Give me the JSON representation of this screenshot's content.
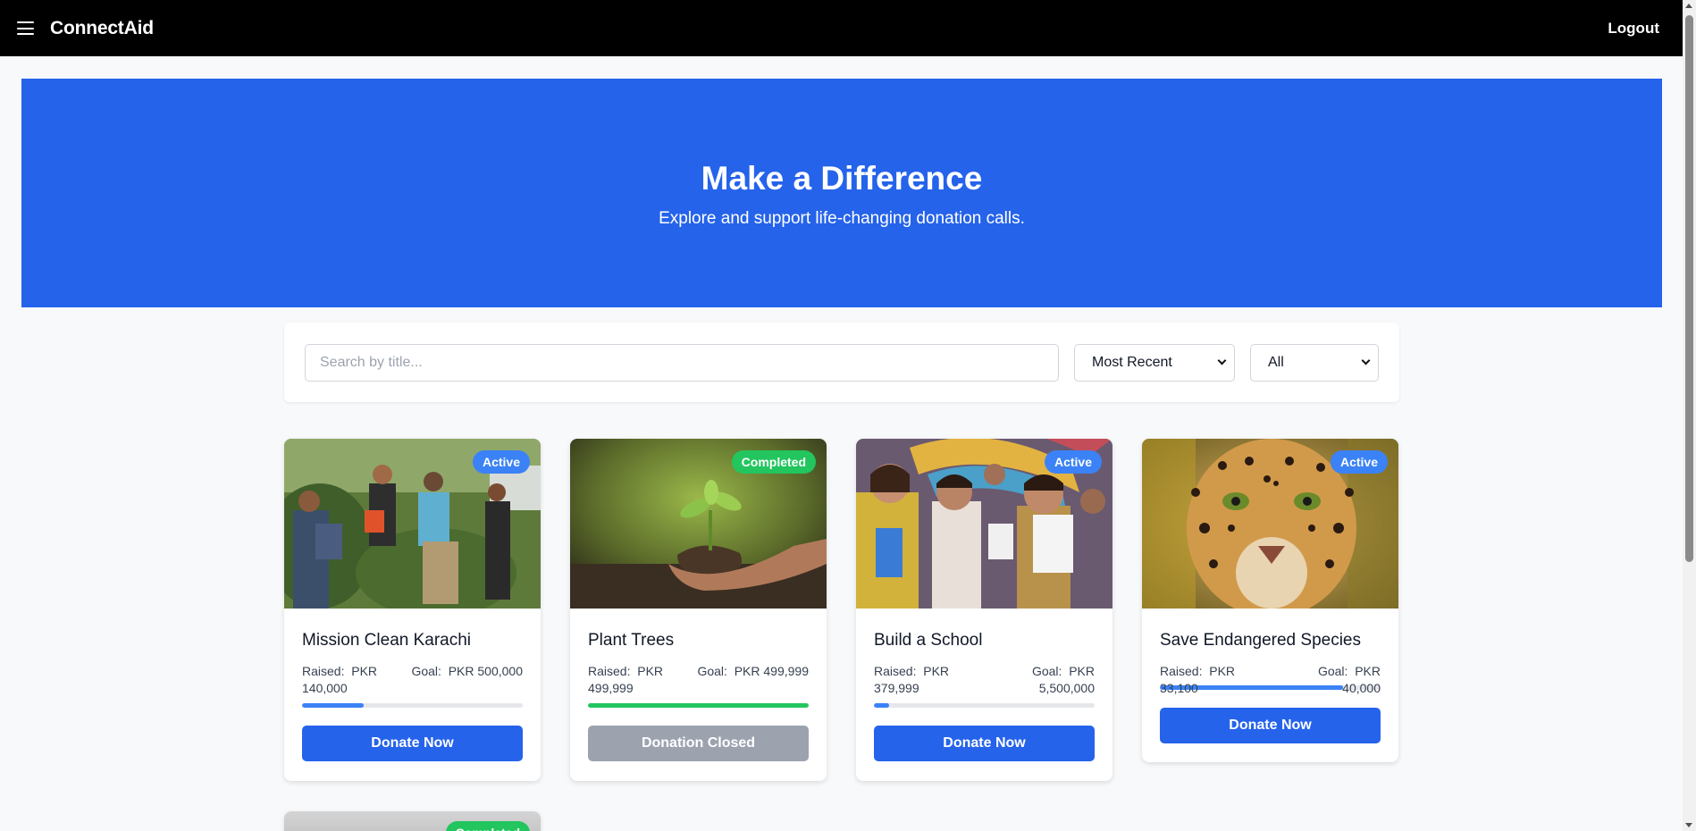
{
  "header": {
    "brand": "ConnectAid",
    "logout_label": "Logout"
  },
  "hero": {
    "title": "Make a Difference",
    "subtitle": "Explore and support life-changing donation calls."
  },
  "filters": {
    "search_placeholder": "Search by title...",
    "sort_selected": "Most Recent",
    "status_selected": "All"
  },
  "labels": {
    "raised": "Raised:",
    "goal": "Goal:"
  },
  "cards": [
    {
      "title": "Mission Clean Karachi",
      "status": "Active",
      "raised": "PKR 140,000",
      "goal": "PKR 500,000",
      "progress": 0.28,
      "button": "Donate Now",
      "progress_color": "#3b82f6"
    },
    {
      "title": "Plant Trees",
      "status": "Completed",
      "raised": "PKR 499,999",
      "goal": "PKR 499,999",
      "progress": 1.0,
      "button": "Donation Closed",
      "progress_color": "#22c55e"
    },
    {
      "title": "Build a School",
      "status": "Active",
      "raised": "PKR 379,999",
      "goal": "PKR 5,500,000",
      "progress": 0.069,
      "button": "Donate Now",
      "progress_color": "#3b82f6"
    },
    {
      "title": "Save Endangered Species",
      "status": "Active",
      "raised": "PKR 33,100",
      "goal": "PKR 40,000",
      "progress": 0.83,
      "button": "Donate Now",
      "progress_color": "#3b82f6"
    },
    {
      "status": "Completed"
    }
  ],
  "colors": {
    "primary": "#2563eb",
    "active_badge": "#3b82f6",
    "completed_badge": "#22c55e",
    "disabled": "#9ca3af"
  }
}
